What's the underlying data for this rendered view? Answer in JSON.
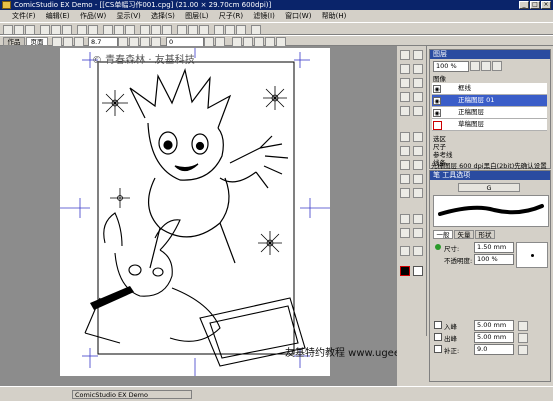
{
  "window": {
    "title": "ComicStudio EX Demo - [[CS单幅习作001.cpg] (21.00 × 29.70cm 600dpi)]",
    "controls": [
      "_",
      "□",
      "×"
    ]
  },
  "menu": {
    "items": [
      "文件(F)",
      "编辑(E)",
      "作品(W)",
      "显示(V)",
      "选择(S)",
      "图层(L)",
      "尺子(R)",
      "滤镜(I)",
      "窗口(W)",
      "帮助(H)"
    ]
  },
  "toolbar": {
    "page_tab": "作品",
    "page_tab_active": "页面",
    "brush_size": "8.7",
    "zoom": "0"
  },
  "canvas": {
    "watermark_top": "© 青春森林 · 友基科技",
    "watermark_bottom": "友基特约教程 www.ugee.com.cn"
  },
  "layers_panel": {
    "title": "图层",
    "opacity": "100 %",
    "group_label": "图像",
    "layers": [
      {
        "name": "框线",
        "active": false
      },
      {
        "name": "正稿图层 01",
        "active": true
      },
      {
        "name": "正稿图层",
        "active": false
      },
      {
        "name": "草稿图层",
        "active": false
      }
    ],
    "sections": [
      "选区",
      "尺子",
      "参考线",
      "线条"
    ],
    "info": "光栅图层 600 dpi黑白(2bit)先确认设置"
  },
  "tool_options": {
    "title": "笔 工具选项",
    "preset": "G",
    "tabs": [
      "一般",
      "矢量",
      "形状"
    ],
    "size_label": "尺寸:",
    "size_value": "1.50 mm",
    "opacity_label": "不透明度:",
    "opacity_value": "100 %",
    "in_label": "入峰",
    "in_value": "5.00 mm",
    "out_label": "出峰",
    "out_value": "5.00 mm",
    "correction_label": "补正:",
    "correction_value": "9.0"
  },
  "statusbar": {
    "text": "ComicStudio EX Demo"
  },
  "colors": {
    "titlebar": "#0a246a",
    "panel_header": "#2a4ba0",
    "active_layer": "#3a5dc8",
    "chrome": "#d4d0c8",
    "canvas_bg": "#8c8c8c"
  }
}
